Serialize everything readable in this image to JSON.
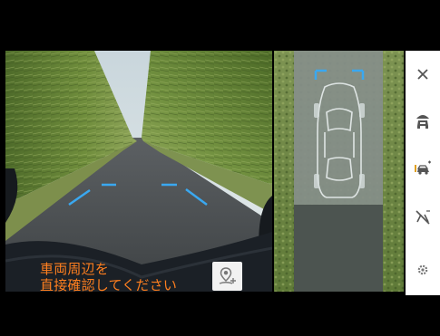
{
  "warning": {
    "line1": "車両周辺を",
    "line2": "直接確認してください"
  },
  "buttons": {
    "help": {
      "icon": "location-person-icon"
    },
    "close": {
      "icon": "close-icon"
    },
    "view_front": {
      "icon": "car-front-view-icon"
    },
    "view_side": {
      "icon": "car-side-camera-icon"
    },
    "guide_off": {
      "icon": "guide-line-off-icon"
    },
    "settings": {
      "icon": "gear-icon"
    }
  },
  "colors": {
    "warning_text": "#ff7f1f",
    "guide_line": "#3aa8f0",
    "menu_background": "#ffffff",
    "menu_icon": "#555555"
  }
}
